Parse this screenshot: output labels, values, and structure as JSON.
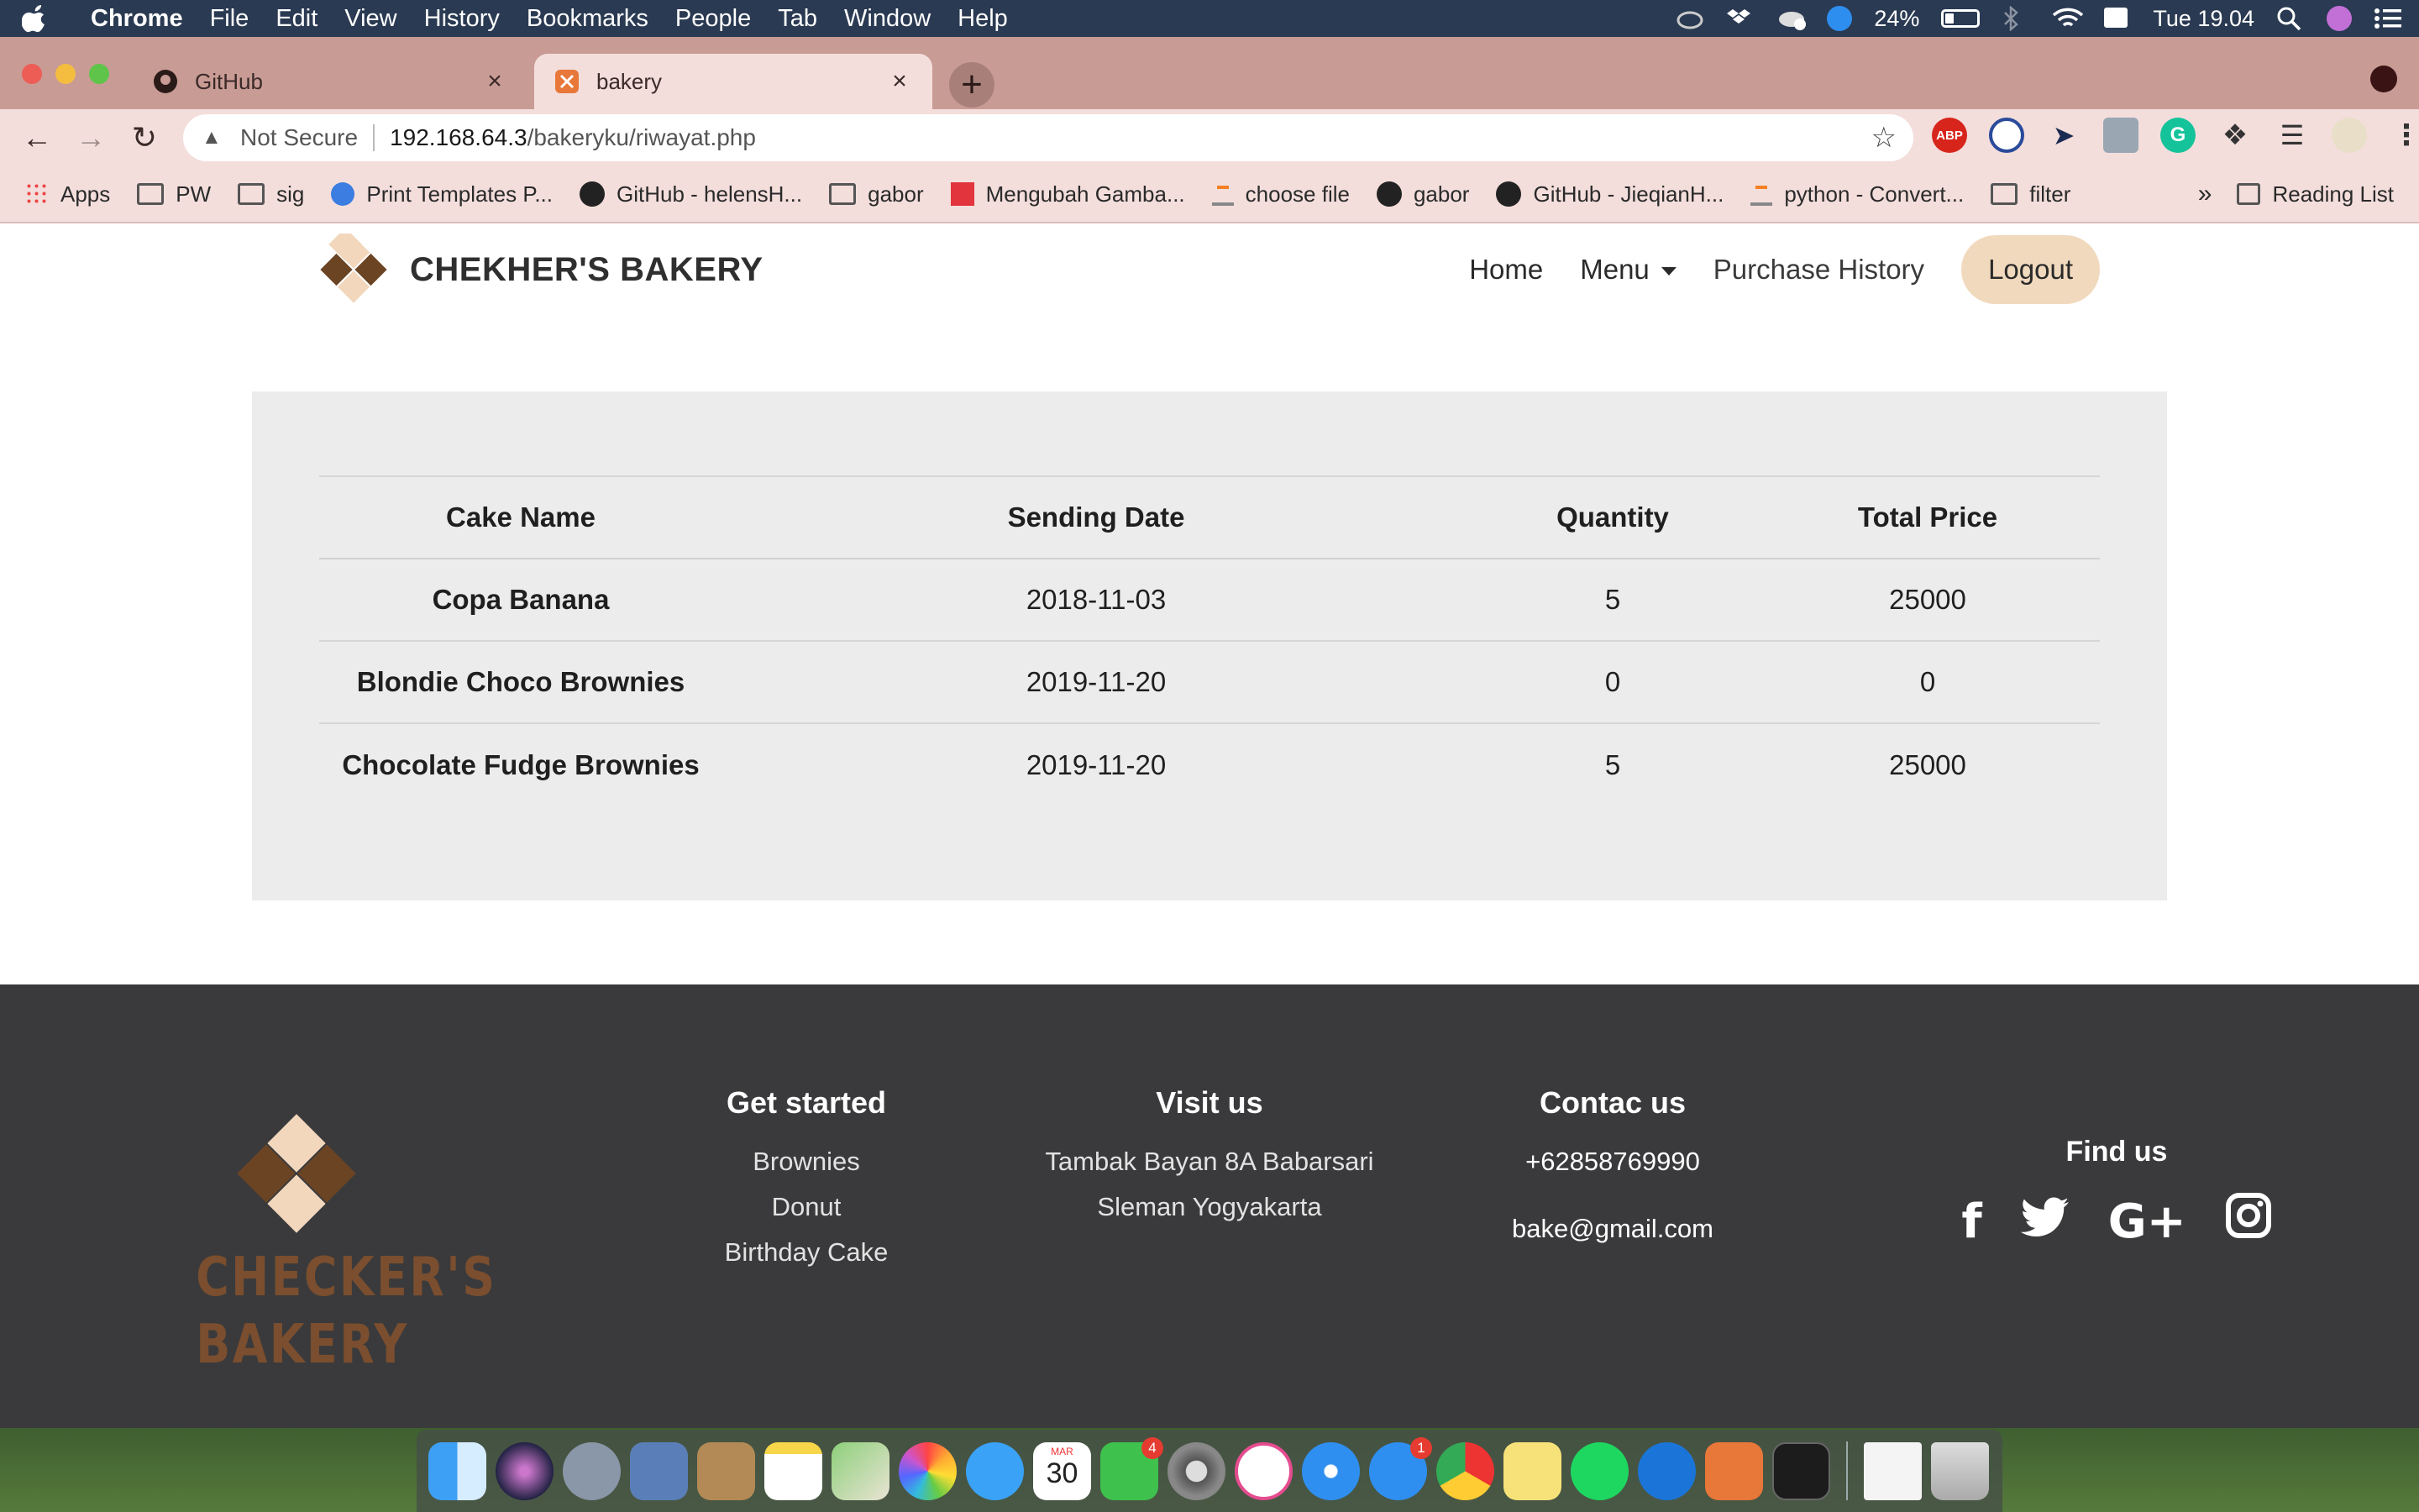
{
  "mac_menubar": {
    "app_name": "Chrome",
    "menus": [
      "File",
      "Edit",
      "View",
      "History",
      "Bookmarks",
      "People",
      "Tab",
      "Window",
      "Help"
    ],
    "battery": "24%",
    "clock": "Tue 19.04"
  },
  "browser": {
    "tabs": [
      {
        "title": "GitHub",
        "active": false
      },
      {
        "title": "bakery",
        "active": true
      }
    ],
    "new_tab_label": "+",
    "security_label": "Not Secure",
    "url_host": "192.168.64.3",
    "url_path": "/bakeryku/riwayat.php",
    "bookmarks": [
      "Apps",
      "PW",
      "sig",
      "Print Templates P...",
      "GitHub - helensH...",
      "gabor",
      "Mengubah Gamba...",
      "choose file",
      "gabor",
      "GitHub - JieqianH...",
      "python - Convert...",
      "filter"
    ],
    "more_bookmarks": "»",
    "reading_list": "Reading List"
  },
  "site": {
    "brand_name": "CHEKHER'S BAKERY",
    "nav": {
      "home": "Home",
      "menu": "Menu",
      "purchase_history": "Purchase History",
      "logout": "Logout"
    },
    "history_table": {
      "headers": [
        "Cake Name",
        "Sending Date",
        "Quantity",
        "Total Price"
      ],
      "rows": [
        {
          "cake": "Copa Banana",
          "date": "2018-11-03",
          "qty": "5",
          "price": "25000"
        },
        {
          "cake": "Blondie Choco Brownies",
          "date": "2019-11-20",
          "qty": "0",
          "price": "0"
        },
        {
          "cake": "Chocolate Fudge Brownies",
          "date": "2019-11-20",
          "qty": "5",
          "price": "25000"
        }
      ]
    },
    "footer": {
      "logo_line1": "CHECKER'S",
      "logo_line2": "BAKERY",
      "get_started": {
        "title": "Get started",
        "items": [
          "Brownies",
          "Donut",
          "Birthday Cake"
        ]
      },
      "visit_us": {
        "title": "Visit us",
        "lines": [
          "Tambak Bayan 8A Babarsari",
          "Sleman Yogyakarta"
        ]
      },
      "contact_us": {
        "title": "Contac us",
        "phone": "+62858769990",
        "email": "bake@gmail.com"
      },
      "find_us": {
        "title": "Find us",
        "icons": [
          "facebook-icon",
          "twitter-icon",
          "google-plus-icon",
          "instagram-icon"
        ]
      }
    }
  },
  "dock": {
    "calendar_month": "MAR",
    "calendar_day": "30",
    "facetime_badge": "4",
    "appstore_badge": "1"
  },
  "colors": {
    "menubar": "#2a3a52",
    "tabstrip": "#c99b95",
    "toolbar": "#f3dedc",
    "logout_button": "#f1d9bd",
    "panel": "#ececec",
    "footer": "#3a3a3c",
    "brand_dark": "#6b4423",
    "brand_light": "#f2d7bd"
  }
}
